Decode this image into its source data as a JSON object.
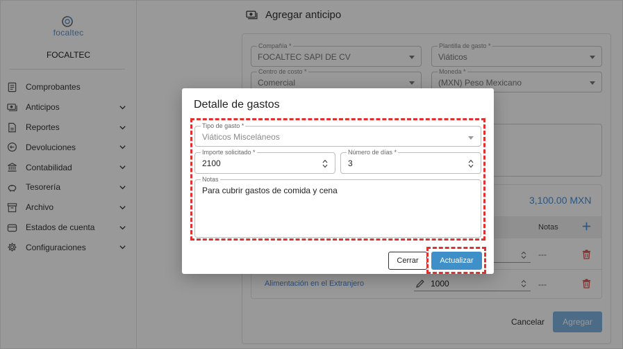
{
  "sidebar": {
    "logo_text": "focaltec",
    "company_name": "FOCALTEC",
    "items": [
      {
        "label": "Comprobantes",
        "icon": "document-icon",
        "has_submenu": false
      },
      {
        "label": "Anticipos",
        "icon": "money-icon",
        "has_submenu": true
      },
      {
        "label": "Reportes",
        "icon": "report-icon",
        "has_submenu": true
      },
      {
        "label": "Devoluciones",
        "icon": "return-icon",
        "has_submenu": true
      },
      {
        "label": "Contabilidad",
        "icon": "bank-icon",
        "has_submenu": true
      },
      {
        "label": "Tesorería",
        "icon": "piggy-bank-icon",
        "has_submenu": true
      },
      {
        "label": "Archivo",
        "icon": "archive-icon",
        "has_submenu": true
      },
      {
        "label": "Estados de cuenta",
        "icon": "wallet-icon",
        "has_submenu": true
      },
      {
        "label": "Configuraciones",
        "icon": "gear-icon",
        "has_submenu": true
      }
    ]
  },
  "page": {
    "title": "Agregar anticipo",
    "title_icon": "money-icon"
  },
  "form": {
    "compania": {
      "label": "Compañía *",
      "value": "FOCALTEC SAPI DE CV"
    },
    "plantilla": {
      "label": "Plantilla de gasto *",
      "value": "Viáticos"
    },
    "centro_costo": {
      "label": "Centro de costo *",
      "value": "Comercial"
    },
    "moneda": {
      "label": "Moneda *",
      "value": "(MXN) Peso Mexicano"
    }
  },
  "summary": {
    "total": "3,100.00 MXN",
    "columns": {
      "notas": "Notas"
    },
    "rows": [
      {
        "concepto": "",
        "importe": "",
        "notas": "---"
      },
      {
        "concepto": "Alimentación en el Extranjero",
        "importe": "1000",
        "notas": "---"
      }
    ],
    "cancel_label": "Cancelar",
    "add_label": "Agregar"
  },
  "dialog": {
    "title": "Detalle de gastos",
    "tipo_gasto": {
      "label": "Tipo de gasto *",
      "value": "Viáticos Misceláneos"
    },
    "importe": {
      "label": "Importe solicitado *",
      "value": "2100"
    },
    "dias": {
      "label": "Número de días *",
      "value": "3"
    },
    "notas": {
      "label": "Notas",
      "value": "Para cubrir gastos de comida y cena"
    },
    "close_label": "Cerrar",
    "update_label": "Actualizar"
  },
  "colors": {
    "primary": "#3f8fc8",
    "primary_disabled": "#7fb3e0",
    "link": "#4a80c8",
    "danger": "#e04646",
    "highlight": "#e03030",
    "overlay": "rgba(0,0,0,0.40)"
  }
}
